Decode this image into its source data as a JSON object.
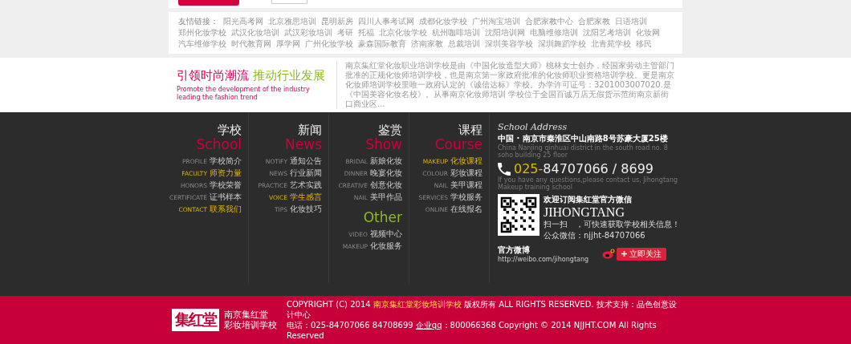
{
  "links": {
    "label": "友情链接：",
    "items": [
      "阳光高考网",
      "北京雅思培训",
      "昆明新房",
      "四川人事考试网",
      "成都化妆学校",
      "广州淘宝培训",
      "合肥家教中心",
      "合肥家教",
      "日语培训",
      "郑州化妆学校",
      "武汉化妆培训",
      "武汉彩妆培训",
      "考研",
      "托福",
      "北京化妆学校",
      "杭州咖啡培训",
      "沈阳培训网",
      "电脑维修培训",
      "沈阳艺考培训",
      "化妆网",
      "汽车维修学校",
      "时代教育网",
      "厚学网",
      "广州化妆学校",
      "豪森国际教育",
      "济南家教",
      "总裁培训",
      "深圳美容学校",
      "深圳舞蹈学校",
      "北青苑学校",
      "移民"
    ]
  },
  "banner": {
    "slogan_a": "引领时尚潮流",
    "slogan_b": "推动行业发展",
    "subtitle": "Promote the development of the industry leading the fashion trend",
    "intro": "南京集红堂化妆职业培训学校是由《中国化妆造型大师》桃林女士创办，经国家劳动主管部门批准的正规化妆师培训学校，也是南京第一家政府批准的化妆师职业资格培训学校。更是南京化妆师培训学校里唯一政府认定的《诚信达标》学校。办学许可证号：3201003007020.是《中国美容化妆名校》。从事南京化妆师培训 学校位于全国百诚万店无假货示范街南京新街口商业区..."
  },
  "footer_columns": [
    {
      "title_cn": "学校",
      "title_en": "School",
      "items": [
        {
          "en": "PROFILE",
          "cn": "学校简介",
          "highlighted": false
        },
        {
          "en": "FACULTY",
          "cn": "师资力量",
          "highlighted": true
        },
        {
          "en": "HONORS",
          "cn": "学校荣誉",
          "highlighted": false
        },
        {
          "en": "CERTIFICATE",
          "cn": "证书样本",
          "highlighted": false
        },
        {
          "en": "CONTACT",
          "cn": "联系我们",
          "highlighted": true
        }
      ]
    },
    {
      "title_cn": "新闻",
      "title_en": "News",
      "items": [
        {
          "en": "NOTIFY",
          "cn": "通知公告",
          "highlighted": false
        },
        {
          "en": "NEWS",
          "cn": "行业新闻",
          "highlighted": false
        },
        {
          "en": "PRACTICE",
          "cn": "艺术实践",
          "highlighted": false
        },
        {
          "en": "VOICE",
          "cn": "学生感言",
          "highlighted": true
        },
        {
          "en": "TIPS",
          "cn": "化妆技巧",
          "highlighted": false
        }
      ]
    },
    {
      "title_cn": "鉴赏",
      "title_en": "Show",
      "items": [
        {
          "en": "BRIDAL",
          "cn": "新娘化妆",
          "highlighted": false
        },
        {
          "en": "DINNER",
          "cn": "晚宴化妆",
          "highlighted": false
        },
        {
          "en": "CREATIVE",
          "cn": "创意化妆",
          "highlighted": false
        },
        {
          "en": "NAIL",
          "cn": "美甲作品",
          "highlighted": false
        }
      ],
      "extra_title": "Other",
      "extra_items": [
        {
          "en": "VIDEO",
          "cn": "视频中心",
          "highlighted": false
        },
        {
          "en": "MAKEUP",
          "cn": "化妆服务",
          "highlighted": false
        }
      ]
    },
    {
      "title_cn": "课程",
      "title_en": "Course",
      "items": [
        {
          "en": "MAKEUP",
          "cn": "化妆课程",
          "highlighted": true
        },
        {
          "en": "COLOUR",
          "cn": "彩妆课程",
          "highlighted": false
        },
        {
          "en": "NAIL",
          "cn": "美甲课程",
          "highlighted": false
        },
        {
          "en": "SERVICES",
          "cn": "学校服务",
          "highlighted": false
        },
        {
          "en": "ONLINE",
          "cn": "在线报名",
          "highlighted": false
        }
      ]
    }
  ],
  "contact": {
    "heading": "School Address",
    "address_cn": "中国 · 南京市秦淮区中山南路8号苏豪大厦25楼",
    "address_en": "China  Nanjing qinhuai district in the south road no. 8 soho building 25 floor",
    "phone_prefix": "025-",
    "phone": "84707066 / 8699",
    "phone_note": "If you have any questions,please contact us, Jihongtang Makeup training school",
    "wechat_title": "欢迎订阅集红堂官方微信",
    "wechat_name": "JIHONGTANG",
    "wechat_scan": "扫一扫　，可快速获取学校相关信息！",
    "wechat_id": "公众微信：njjht-84707066",
    "weibo_title": "官方微博",
    "weibo_url": "http://weibo.com/jihongtang",
    "follow_button": "立即关注"
  },
  "bottom": {
    "logo": "集红堂",
    "school_line1": "南京集红堂",
    "school_line2": "彩妆培训学校",
    "copyright_a": "COPYRIGHT (C) 2014 ",
    "copyright_link": "南京集红堂彩妆培训学校",
    "copyright_b": " 版权所有 ALL RIGHTS RESERVED.  技术支持：品色创意设计中心",
    "contact_a": "电话：025-84707066  84708699  ",
    "qq_label": "企业qq",
    "contact_b": "：800066368    Copyright © 2014 NJJHT.COM All Rights Reserved"
  }
}
